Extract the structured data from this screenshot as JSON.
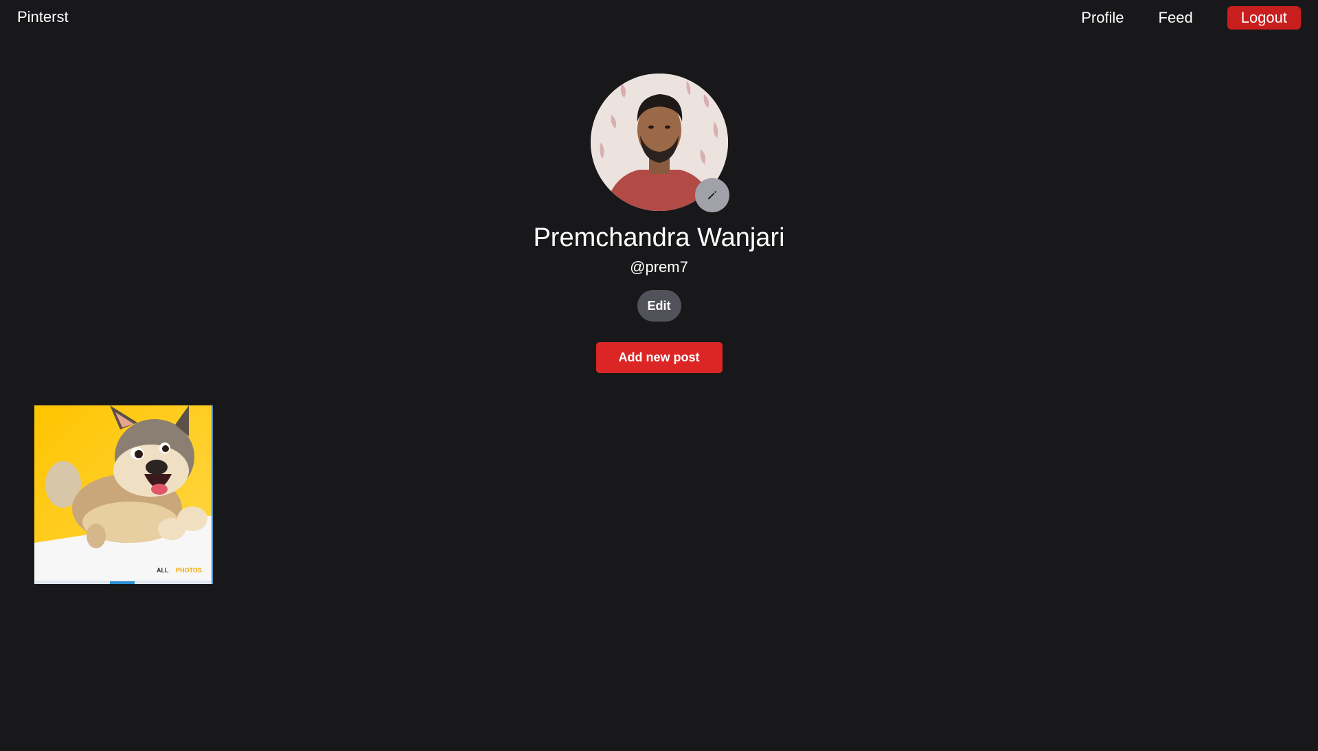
{
  "nav": {
    "brand": "Pinterst",
    "links": {
      "profile": "Profile",
      "feed": "Feed",
      "logout": "Logout"
    }
  },
  "profile": {
    "name": "Premchandra Wanjari",
    "handle": "@prem7",
    "edit_label": "Edit",
    "add_post_label": "Add new post",
    "avatar_icon": "user-avatar-photo",
    "edit_avatar_icon": "pencil-icon"
  },
  "posts": [
    {
      "image": "cartoon-dog-on-yellow-background",
      "overlay_text_1": "ALL",
      "overlay_text_2": "PHOTOS"
    }
  ],
  "colors": {
    "background": "#18181b",
    "logout": "#c81e1e",
    "add_post": "#dc2626",
    "edit_button": "#52525b",
    "avatar_edit_button": "#a1a1aa"
  }
}
